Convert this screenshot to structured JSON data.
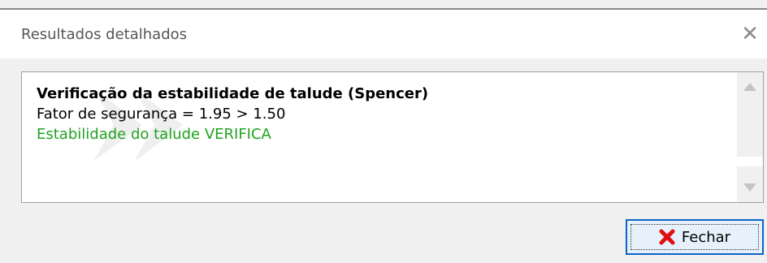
{
  "window": {
    "title": "Resultados detalhados",
    "close_glyph": "✕"
  },
  "results": {
    "heading": "Verificação da estabilidade de talude (Spencer)",
    "safety_factor_line": "Fator de segurança = 1.95 > 1.50",
    "status_line": "Estabilidade do talude VERIFICA",
    "status_color": "#1fa31f"
  },
  "footer": {
    "close_button_label": "Fechar",
    "close_button_icon": "red-x-icon",
    "close_button_icon_color": "#e01010"
  },
  "icons": {
    "scroll_up": "scroll-up-arrow-icon",
    "scroll_down": "scroll-down-arrow-icon"
  }
}
